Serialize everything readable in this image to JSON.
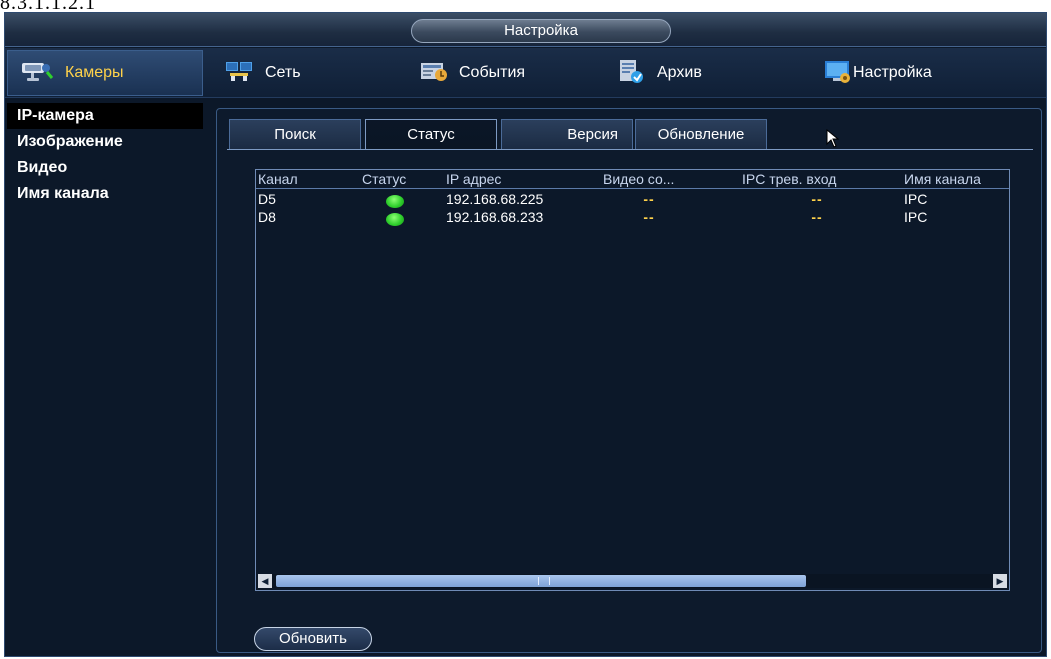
{
  "doc_label": "8.3.1.1.2.1",
  "window": {
    "title": "Настройка"
  },
  "nav": {
    "cameras": "Камеры",
    "items": [
      {
        "label": "Сеть",
        "icon": "network-icon"
      },
      {
        "label": "События",
        "icon": "events-icon"
      },
      {
        "label": "Архив",
        "icon": "archive-icon"
      },
      {
        "label": "Настройка",
        "icon": "settings-icon"
      }
    ]
  },
  "sidebar": {
    "items": [
      {
        "label": "IP-камера",
        "active": true
      },
      {
        "label": "Изображение",
        "active": false
      },
      {
        "label": "Видео",
        "active": false
      },
      {
        "label": "Имя канала",
        "active": false
      }
    ]
  },
  "tabs": [
    {
      "label": "Поиск",
      "active": false
    },
    {
      "label": "Статус",
      "active": true
    },
    {
      "label": "Версия",
      "active": false
    },
    {
      "label": "Обновление",
      "active": false
    }
  ],
  "table": {
    "columns": [
      "Канал",
      "Статус",
      "IP адрес",
      "Видео со...",
      "IPC трев. вход",
      "Имя канала"
    ],
    "rows": [
      {
        "channel": "D5",
        "status": "online",
        "ip": "192.168.68.225",
        "video": "--",
        "alarm": "--",
        "name": "IPC"
      },
      {
        "channel": "D8",
        "status": "online",
        "ip": "192.168.68.233",
        "video": "--",
        "alarm": "--",
        "name": "IPC"
      }
    ]
  },
  "buttons": {
    "refresh": "Обновить"
  },
  "colors": {
    "background": "#0c1829",
    "accent": "#ffd24a",
    "status_online": "#2fcf2d"
  }
}
